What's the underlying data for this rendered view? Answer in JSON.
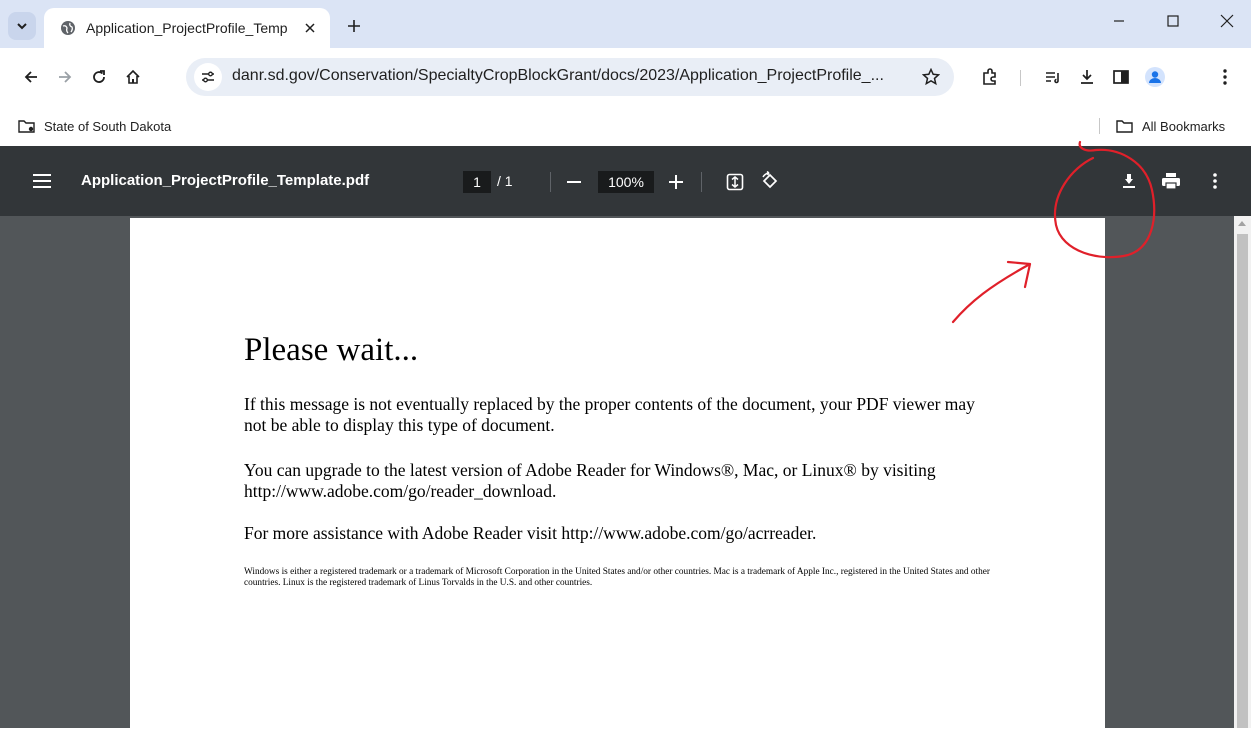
{
  "browser": {
    "tab": {
      "title": "Application_ProjectProfile_Temp"
    },
    "address": {
      "url": "danr.sd.gov/Conservation/SpecialtyCropBlockGrant/docs/2023/Application_ProjectProfile_..."
    },
    "bookmarks": {
      "items": [
        {
          "label": "State of South Dakota",
          "icon": "folder-managed-icon"
        }
      ],
      "all_bookmarks": "All Bookmarks"
    }
  },
  "pdf_viewer": {
    "filename": "Application_ProjectProfile_Template.pdf",
    "current_page": "1",
    "total_pages": "/  1",
    "zoom": "100%"
  },
  "document": {
    "heading": "Please wait...",
    "paragraphs": [
      "If this message is not eventually replaced by the proper contents of the document, your PDF viewer may not be able to display this type of document.",
      "You can upgrade to the latest version of Adobe Reader for Windows®, Mac, or Linux® by visiting  http://www.adobe.com/go/reader_download.",
      "For more assistance with Adobe Reader visit  http://www.adobe.com/go/acrreader."
    ],
    "trademark_note": "Windows is either a registered trademark or a trademark of Microsoft Corporation in the United States and/or other countries. Mac is a trademark of Apple Inc., registered in the United States and other countries. Linux is the registered trademark of Linus Torvalds in the U.S. and other countries."
  },
  "colors": {
    "tabstrip": "#dbe4f5",
    "pdf_toolbar": "#323639",
    "viewer_bg": "#525659",
    "annotation": "#e0202a",
    "profile_accent": "#1a73e8"
  }
}
